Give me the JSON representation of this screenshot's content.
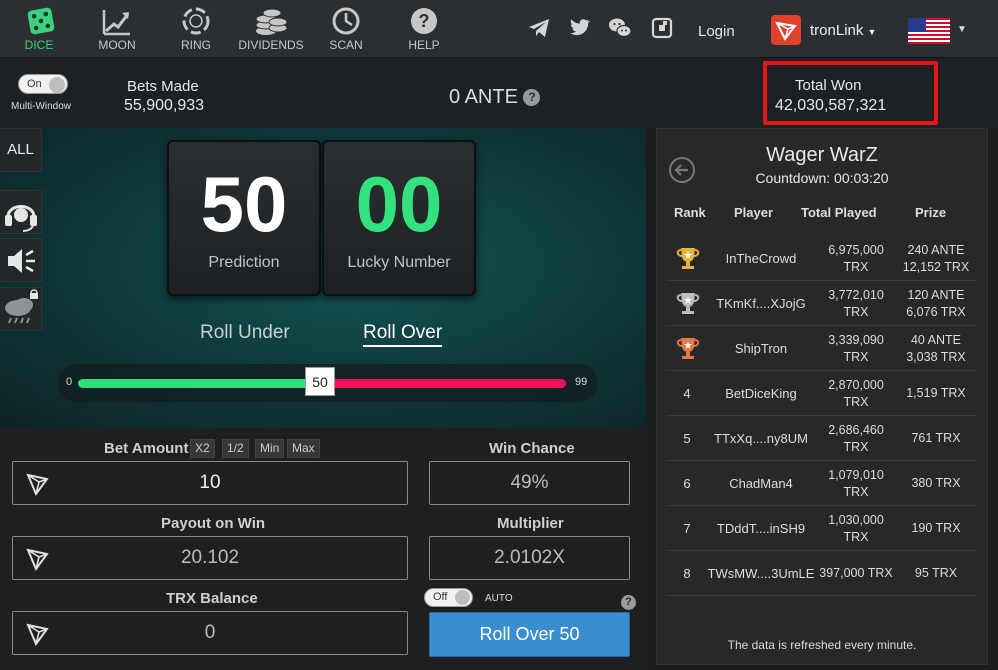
{
  "nav": [
    {
      "label": "DICE",
      "icon": "dice-icon"
    },
    {
      "label": "MOON",
      "icon": "moon-chart-icon"
    },
    {
      "label": "RING",
      "icon": "ring-icon"
    },
    {
      "label": "DIVIDENDS",
      "icon": "coins-icon"
    },
    {
      "label": "SCAN",
      "icon": "clock-icon"
    },
    {
      "label": "HELP",
      "icon": "help-icon"
    }
  ],
  "header": {
    "login": "Login",
    "wallet": "tronLink",
    "social_icons": [
      "telegram-icon",
      "twitter-icon",
      "wechat-icon",
      "game-icon"
    ]
  },
  "stats": {
    "multi_window_toggle": "On",
    "multi_window_label": "Multi-Window",
    "bets_made_label": "Bets Made",
    "bets_made_value": "55,900,933",
    "ante_label": "0 ANTE",
    "total_won_label": "Total Won",
    "total_won_value": "42,030,587,321"
  },
  "side": {
    "all_label": "ALL"
  },
  "game": {
    "prediction": "50",
    "prediction_label": "Prediction",
    "lucky_number": "00",
    "lucky_label": "Lucky Number",
    "roll_under": "Roll Under",
    "roll_over": "Roll Over",
    "slider_min": "0",
    "slider_max": "99",
    "slider_value": "50",
    "slider_fraction": 0.5
  },
  "controls": {
    "bet_amount_label": "Bet Amount",
    "bet_buttons": [
      "X2",
      "1/2",
      "Min",
      "Max"
    ],
    "bet_amount": "10",
    "win_chance_label": "Win Chance",
    "win_chance": "49%",
    "payout_label": "Payout on Win",
    "payout": "20.102",
    "multiplier_label": "Multiplier",
    "multiplier": "2.0102X",
    "balance_label": "TRX Balance",
    "balance": "0",
    "auto_toggle": "Off",
    "auto_label": "AUTO",
    "roll_button": "Roll Over 50"
  },
  "leaderboard": {
    "title": "Wager WarZ",
    "countdown": "Countdown: 00:03:20",
    "columns": [
      "Rank",
      "Player",
      "Total Played",
      "Prize"
    ],
    "rows": [
      {
        "rank": "",
        "trophy": "gold",
        "player": "InTheCrowd",
        "played1": "6,975,000",
        "played2": "TRX",
        "prize1": "240 ANTE",
        "prize2": "12,152 TRX"
      },
      {
        "rank": "",
        "trophy": "silver",
        "player": "TKmKf....XJojG",
        "played1": "3,772,010",
        "played2": "TRX",
        "prize1": "120 ANTE",
        "prize2": "6,076 TRX"
      },
      {
        "rank": "",
        "trophy": "bronze",
        "player": "ShipTron",
        "played1": "3,339,090",
        "played2": "TRX",
        "prize1": "40 ANTE",
        "prize2": "3,038 TRX"
      },
      {
        "rank": "4",
        "player": "BetDiceKing",
        "played1": "2,870,000",
        "played2": "TRX",
        "prize1": "1,519 TRX",
        "prize2": ""
      },
      {
        "rank": "5",
        "player": "TTxXq....ny8UM",
        "played1": "2,686,460",
        "played2": "TRX",
        "prize1": "761 TRX",
        "prize2": ""
      },
      {
        "rank": "6",
        "player": "ChadMan4",
        "played1": "1,079,010",
        "played2": "TRX",
        "prize1": "380 TRX",
        "prize2": ""
      },
      {
        "rank": "7",
        "player": "TDddT....inSH9",
        "played1": "1,030,000",
        "played2": "TRX",
        "prize1": "190 TRX",
        "prize2": ""
      },
      {
        "rank": "8",
        "player": "TWsMW....3UmLE",
        "played1": "397,000 TRX",
        "played2": "",
        "prize1": "95 TRX",
        "prize2": ""
      }
    ],
    "note": "The data is refreshed every minute."
  }
}
